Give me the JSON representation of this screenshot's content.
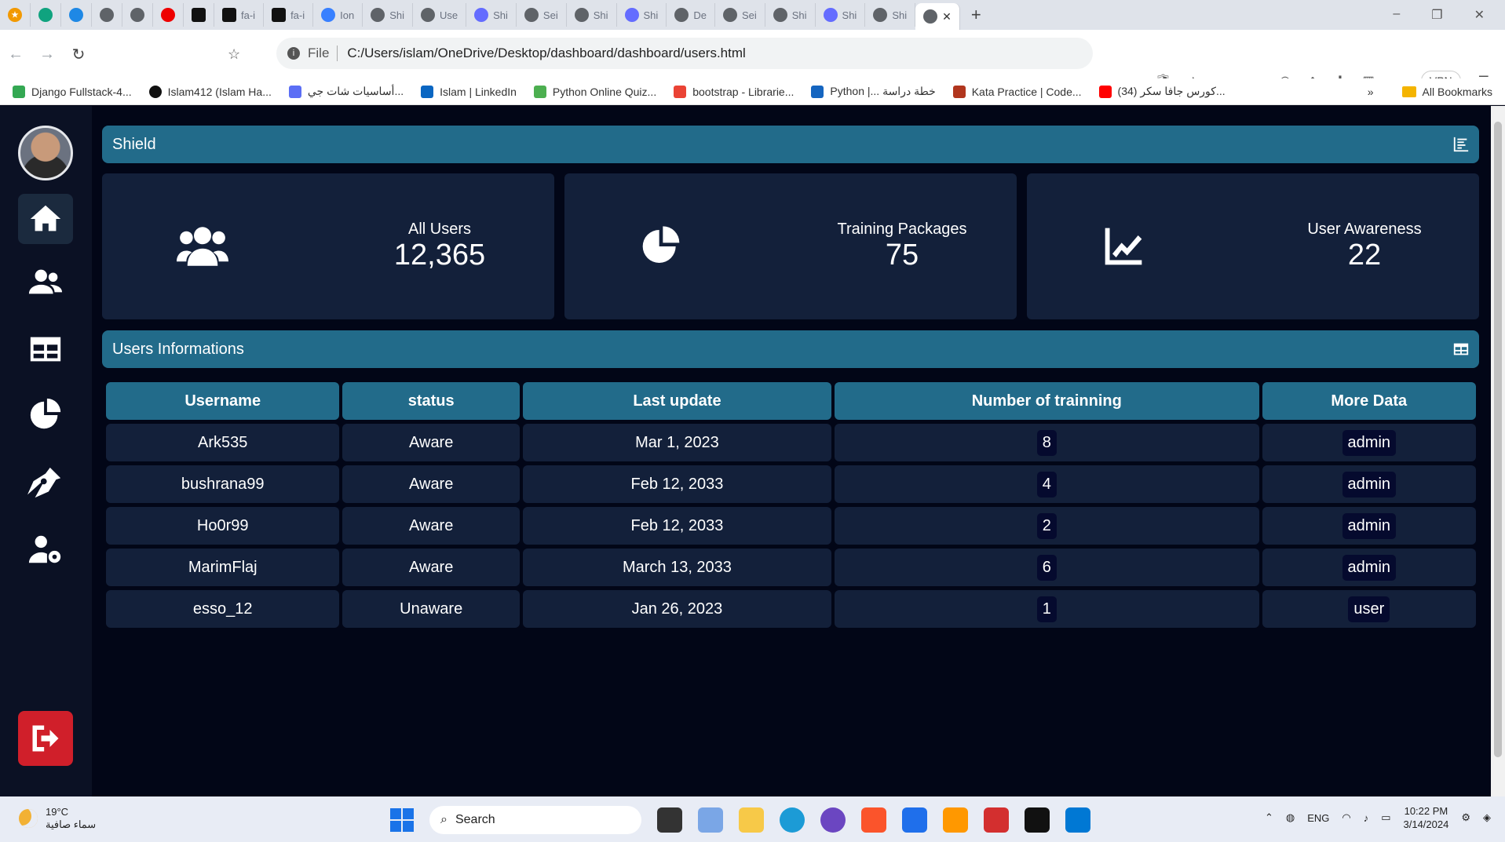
{
  "browser": {
    "tabs": [
      {
        "label": "",
        "icon": "star-extension-icon"
      },
      {
        "label": "",
        "icon": "chatgpt-icon"
      },
      {
        "label": "",
        "icon": "app-icon"
      },
      {
        "label": "",
        "icon": "globe-icon"
      },
      {
        "label": "",
        "icon": "globe-icon"
      },
      {
        "label": "",
        "icon": "opera-icon"
      },
      {
        "label": "",
        "icon": "flag-icon"
      },
      {
        "label": "fa-i",
        "icon": "flag-icon"
      },
      {
        "label": "fa-i",
        "icon": "flag-icon"
      },
      {
        "label": "Ion",
        "icon": "ionic-icon"
      },
      {
        "label": "Shi",
        "icon": "globe-icon"
      },
      {
        "label": "Use",
        "icon": "globe-icon"
      },
      {
        "label": "Shi",
        "icon": "vite-icon"
      },
      {
        "label": "Sei",
        "icon": "globe-icon"
      },
      {
        "label": "Shi",
        "icon": "globe-icon"
      },
      {
        "label": "Shi",
        "icon": "vite-icon"
      },
      {
        "label": "De",
        "icon": "globe-icon"
      },
      {
        "label": "Sei",
        "icon": "globe-icon"
      },
      {
        "label": "Shi",
        "icon": "globe-icon"
      },
      {
        "label": "Shi",
        "icon": "vite-icon"
      },
      {
        "label": "Shi",
        "icon": "globe-icon"
      },
      {
        "label": "Shi",
        "icon": "globe-icon"
      }
    ],
    "address": {
      "scheme_label": "File",
      "url": "C:/Users/islam/OneDrive/Desktop/dashboard/dashboard/users.html"
    },
    "vpn_label": "VPN",
    "bookmarks": [
      {
        "label": "Django Fullstack-4...",
        "icon": "google-drive-icon",
        "color": "#34a853"
      },
      {
        "label": "Islam412 (Islam Ha...",
        "icon": "github-icon",
        "color": "#111111"
      },
      {
        "label": "أساسيات شات جي...",
        "icon": "code-icon",
        "color": "#5b6ef5"
      },
      {
        "label": "Islam | LinkedIn",
        "icon": "linkedin-icon",
        "color": "#0a66c2"
      },
      {
        "label": "Python Online Quiz...",
        "icon": "quiz-icon",
        "color": "#4caf50"
      },
      {
        "label": "bootstrap - Librarie...",
        "icon": "code-icon",
        "color": "#ea4335"
      },
      {
        "label": "Python |... خطة دراسة",
        "icon": "e-icon",
        "color": "#1565c0"
      },
      {
        "label": "Kata Practice | Code...",
        "icon": "codewars-icon",
        "color": "#b1361e"
      },
      {
        "label": "(34) كورس جافا سكر...",
        "icon": "youtube-icon",
        "color": "#ff0000"
      }
    ],
    "all_bookmarks_label": "All Bookmarks"
  },
  "header": {
    "title": "Shield"
  },
  "stats": [
    {
      "title": "All Users",
      "value": "12,365",
      "icon": "users-icon"
    },
    {
      "title": "Training Packages",
      "value": "75",
      "icon": "pie-chart-icon"
    },
    {
      "title": "User Awareness",
      "value": "22",
      "icon": "line-chart-icon"
    }
  ],
  "section": {
    "title": "Users Informations"
  },
  "table": {
    "columns": [
      "Username",
      "status",
      "Last update",
      "Number of trainning",
      "More Data"
    ],
    "rows": [
      [
        "Ark535",
        "Aware",
        "Mar 1, 2023",
        "8",
        "admin"
      ],
      [
        "bushrana99",
        "Aware",
        "Feb 12, 2033",
        "4",
        "admin"
      ],
      [
        "Ho0r99",
        "Aware",
        "Feb 12, 2033",
        "2",
        "admin"
      ],
      [
        "MarimFlaj",
        "Aware",
        "March 13, 2033",
        "6",
        "admin"
      ],
      [
        "esso_12",
        "Unaware",
        "Jan 26, 2023",
        "1",
        "user"
      ]
    ]
  },
  "taskbar": {
    "weather_temp": "19°C",
    "weather_desc": "سماء صافية",
    "search_placeholder": "Search",
    "language": "ENG",
    "time": "10:22 PM",
    "date": "3/14/2024"
  },
  "colors": {
    "accent": "#226b8a",
    "card": "#13203a",
    "sidebar": "#0b1124",
    "logout": "#d01f2a",
    "background": "#020617"
  }
}
